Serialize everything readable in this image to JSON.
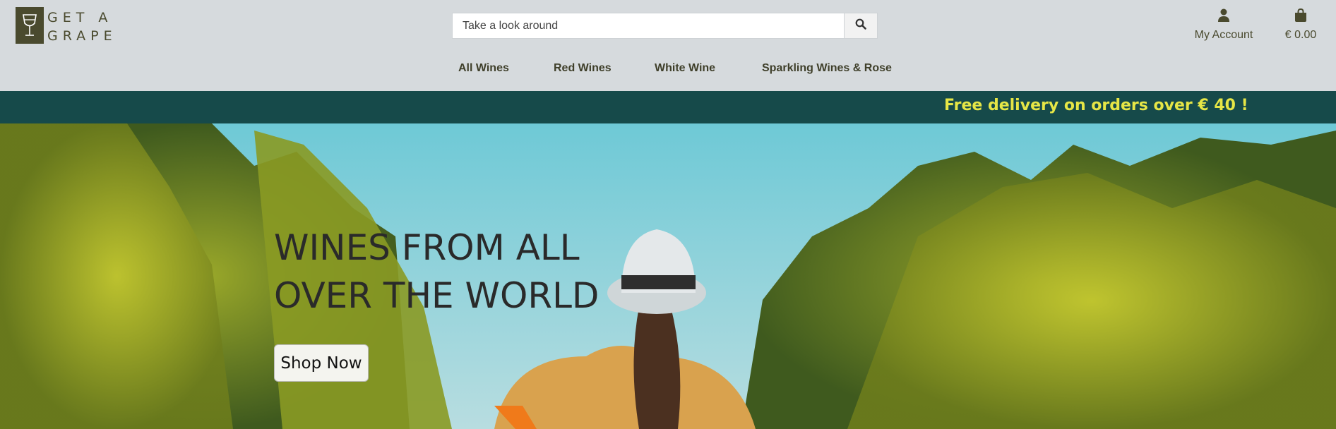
{
  "brand": {
    "line1": "GET A",
    "line2": "GRAPE",
    "icon": "wine-glass-icon"
  },
  "search": {
    "placeholder": "Take a look around",
    "value": "",
    "icon": "search-icon"
  },
  "account": {
    "label": "My Account",
    "icon": "user-icon"
  },
  "cart": {
    "total": "€ 0.00",
    "icon": "shopping-bag-icon"
  },
  "nav": {
    "items": [
      {
        "label": "All Wines"
      },
      {
        "label": "Red Wines"
      },
      {
        "label": "White Wine"
      },
      {
        "label": "Sparkling Wines & Rose"
      }
    ]
  },
  "banner": {
    "text": "Free delivery on orders over € 40 !"
  },
  "hero": {
    "title_line1": "WINES FROM ALL",
    "title_line2": "OVER THE WORLD",
    "button": "Shop Now"
  },
  "colors": {
    "header_bg": "#d6dadd",
    "brand": "#4a4a2e",
    "banner_bg": "#164a4a",
    "banner_text": "#e6e646"
  }
}
